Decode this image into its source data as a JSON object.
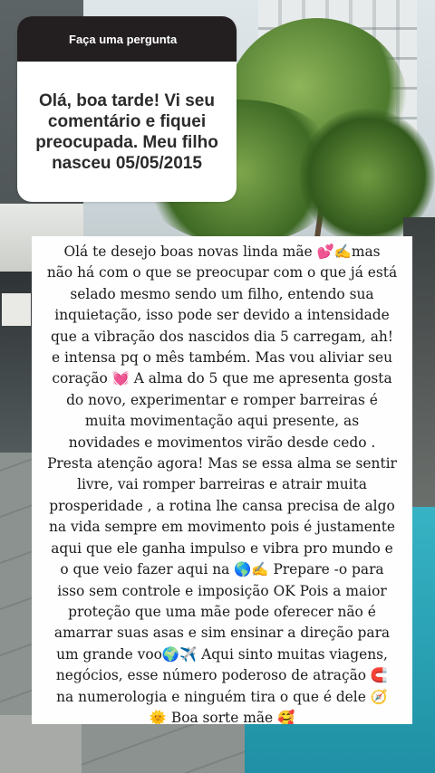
{
  "question_sticker": {
    "header_label": "Faça uma pergunta",
    "question_text": "Olá, boa tarde! Vi seu comentário e fiquei preocupada. Meu filho nasceu 05/05/2015"
  },
  "answer": {
    "text": "Olá te desejo boas novas linda mãe 💕✍️mas\nnão há com o que se preocupar com o que já está\nselado mesmo sendo um filho, entendo sua\ninquietação, isso pode ser devido a intensidade\nque a vibração dos nascidos dia 5 carregam, ah!\ne intensa pq o mês também. Mas vou aliviar seu\ncoração 💓 A alma do 5 que me apresenta gosta\ndo novo, experimentar e romper barreiras é\nmuita movimentação aqui presente, as\nnovidades e movimentos virão desde cedo .\nPresta atenção agora! Mas se essa alma se sentir\nlivre, vai romper barreiras e atrair muita\nprosperidade ,  a rotina lhe cansa precisa de algo\nna vida sempre em movimento pois é justamente\naqui que ele ganha impulso e vibra pro mundo e\no que veio fazer aqui na 🌎✍️ Prepare -o para\nisso sem controle e imposição OK Pois a maior\nproteção que uma mãe pode oferecer não é\namarrar suas asas e sim ensinar a direção para\num grande voo🌍✈️ Aqui sinto muitas viagens,\nnegócios, esse número poderoso de atração 🧲\nna numerologia e ninguém tira o que é dele 🧭\n🌞 Boa sorte mãe 🥰"
  },
  "colors": {
    "sticker_header": "#231f20",
    "sticker_body": "#ffffff",
    "answer_card": "#fefefe",
    "text": "#1b1b1b"
  }
}
